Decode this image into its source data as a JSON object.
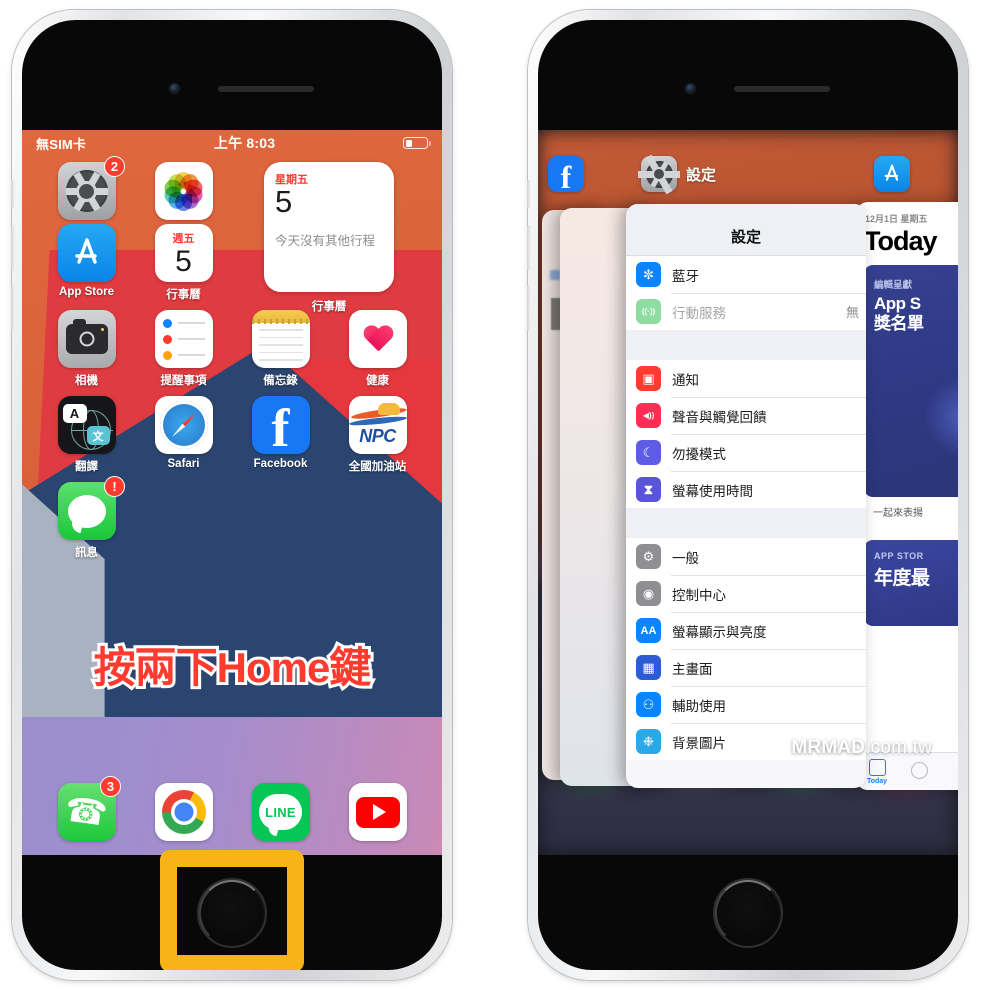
{
  "page": {
    "background": "#ffffff",
    "watermark": {
      "text_bold": "MRMAD",
      "text_light": ".com.tw",
      "logo": "mrmad-bowtie-logo"
    }
  },
  "left_phone": {
    "name": "iPhone home screen",
    "status_bar": {
      "carrier": "無SIM卡",
      "time": "上午 8:03",
      "battery_icon": "battery-icon"
    },
    "apps": [
      {
        "label": "設定",
        "icon": "settings-gear-icon",
        "badge": "2"
      },
      {
        "label": "照片",
        "icon": "photos-flower-icon",
        "badge": ""
      },
      {
        "label": "App Store",
        "icon": "app-store-icon",
        "badge": ""
      },
      {
        "label": "行事曆",
        "icon": "calendar-icon",
        "badge": "",
        "cal_dow": "週五",
        "cal_day": "5"
      },
      {
        "label": "相機",
        "icon": "camera-icon",
        "badge": ""
      },
      {
        "label": "提醒事項",
        "icon": "reminders-icon",
        "badge": ""
      },
      {
        "label": "備忘錄",
        "icon": "notes-icon",
        "badge": ""
      },
      {
        "label": "健康",
        "icon": "health-heart-icon",
        "badge": ""
      },
      {
        "label": "翻譯",
        "icon": "translate-icon",
        "badge": "",
        "glyph_a": "A",
        "glyph_cn": "文"
      },
      {
        "label": "Safari",
        "icon": "safari-compass-icon",
        "badge": ""
      },
      {
        "label": "Facebook",
        "icon": "facebook-icon",
        "badge": "",
        "glyph": "f"
      },
      {
        "label": "全國加油站",
        "icon": "npc-gas-station-icon",
        "badge": "",
        "glyph": "NPC"
      },
      {
        "label": "訊息",
        "icon": "messages-icon",
        "badge": "!"
      }
    ],
    "calendar_widget": {
      "label": "行事曆",
      "day_of_week": "星期五",
      "day_number": "5",
      "note": "今天沒有其他行程"
    },
    "dock": [
      {
        "label": "電話",
        "icon": "phone-icon",
        "badge": "3"
      },
      {
        "label": "Chrome",
        "icon": "chrome-icon",
        "badge": ""
      },
      {
        "label": "LINE",
        "icon": "line-icon",
        "badge": "",
        "glyph": "LINE"
      },
      {
        "label": "YouTube",
        "icon": "youtube-icon",
        "badge": ""
      }
    ],
    "caption": "按兩下Home鍵",
    "caption_color": "#ff3b2f",
    "highlight_box": {
      "target": "home-button",
      "color": "#F8B318"
    }
  },
  "right_phone": {
    "name": "iPhone app switcher",
    "top_app_labels": [
      {
        "name": "Facebook",
        "icon": "facebook-icon"
      },
      {
        "name": "設定",
        "icon": "settings-gear-icon"
      },
      {
        "name": "App Store",
        "icon": "app-store-icon"
      }
    ],
    "settings_card": {
      "nav_title": "設定",
      "groups": [
        {
          "rows": [
            {
              "label": "藍牙",
              "icon": "bluetooth-icon",
              "icon_color": "#0a84ff",
              "glyph": "✼",
              "value": "",
              "dim": false
            },
            {
              "label": "行動服務",
              "icon": "cellular-icon",
              "icon_color": "#8fdda3",
              "glyph": "((·))",
              "value": "無",
              "dim": true
            }
          ]
        },
        {
          "rows": [
            {
              "label": "通知",
              "icon": "notifications-icon",
              "icon_color": "#ff3b30",
              "glyph": "▣",
              "value": "",
              "dim": false
            },
            {
              "label": "聲音與觸覺回饋",
              "icon": "sounds-haptics-icon",
              "icon_color": "#ff2d55",
              "glyph": "◀))",
              "value": "",
              "dim": false
            },
            {
              "label": "勿擾模式",
              "icon": "do-not-disturb-icon",
              "icon_color": "#5e5ce6",
              "glyph": "☾",
              "value": "",
              "dim": false
            },
            {
              "label": "螢幕使用時間",
              "icon": "screen-time-icon",
              "icon_color": "#5856d6",
              "glyph": "⧗",
              "value": "",
              "dim": false
            }
          ]
        },
        {
          "rows": [
            {
              "label": "一般",
              "icon": "general-gear-icon",
              "icon_color": "#8e8e93",
              "glyph": "⚙",
              "value": "",
              "dim": false
            },
            {
              "label": "控制中心",
              "icon": "control-center-icon",
              "icon_color": "#8e8e93",
              "glyph": "◉",
              "value": "",
              "dim": false
            },
            {
              "label": "螢幕顯示與亮度",
              "icon": "display-brightness-icon",
              "icon_color": "#0a84ff",
              "glyph": "AA",
              "value": "",
              "dim": false
            },
            {
              "label": "主畫面",
              "icon": "home-screen-icon",
              "icon_color": "#2b5bd7",
              "glyph": "▦",
              "value": "",
              "dim": false
            },
            {
              "label": "輔助使用",
              "icon": "accessibility-icon",
              "icon_color": "#0a84ff",
              "glyph": "⚇",
              "value": "",
              "dim": false
            },
            {
              "label": "背景圖片",
              "icon": "wallpaper-icon",
              "icon_color": "#2aa9e8",
              "glyph": "❉",
              "value": "",
              "dim": false
            }
          ]
        }
      ]
    },
    "appstore_card": {
      "date": "12月1日 星期五",
      "title": "Today",
      "hero": {
        "kicker": "編輯呈獻",
        "headline_line1": "App S",
        "headline_line2": "獎名單",
        "caption": "一起來表揚"
      },
      "hero2": {
        "kicker": "APP STOR",
        "headline": "年度最"
      },
      "tab_label": "Today"
    }
  }
}
